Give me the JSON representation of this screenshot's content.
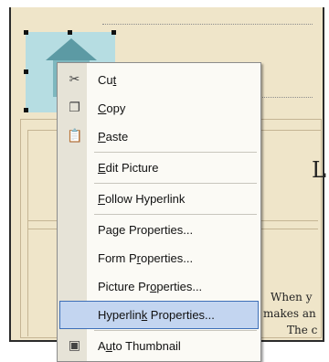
{
  "document": {
    "heading_fragment": "L",
    "body_lines": [
      "When y",
      "makes an",
      "The c"
    ]
  },
  "context_menu": {
    "items": [
      {
        "id": "cut",
        "pre": "Cu",
        "acc": "t",
        "post": "",
        "icon": "scissors-icon"
      },
      {
        "id": "copy",
        "pre": "",
        "acc": "C",
        "post": "opy",
        "icon": "copy-icon"
      },
      {
        "id": "paste",
        "pre": "",
        "acc": "P",
        "post": "aste",
        "icon": "paste-icon"
      },
      {
        "id": "edit-picture",
        "pre": "",
        "acc": "E",
        "post": "dit Picture",
        "icon": ""
      },
      {
        "id": "follow-hyperlink",
        "pre": "",
        "acc": "F",
        "post": "ollow Hyperlink",
        "icon": ""
      },
      {
        "id": "page-properties",
        "pre": "Pa",
        "acc": "g",
        "post": "e Properties...",
        "icon": ""
      },
      {
        "id": "form-properties",
        "pre": "Form P",
        "acc": "r",
        "post": "operties...",
        "icon": ""
      },
      {
        "id": "picture-properties",
        "pre": "Picture Pr",
        "acc": "o",
        "post": "perties...",
        "icon": ""
      },
      {
        "id": "hyperlink-properties",
        "pre": "Hyperlin",
        "acc": "k",
        "post": " Properties...",
        "icon": ""
      },
      {
        "id": "auto-thumbnail",
        "pre": "A",
        "acc": "u",
        "post": "to Thumbnail",
        "icon": "thumbnail-icon"
      }
    ],
    "highlighted": "hyperlink-properties"
  }
}
